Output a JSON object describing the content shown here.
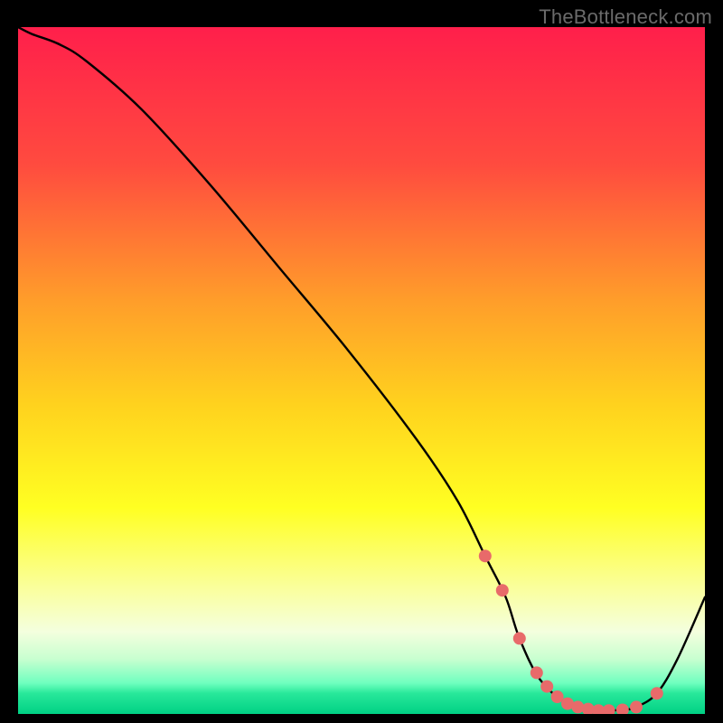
{
  "watermark": "TheBottleneck.com",
  "chart_data": {
    "type": "line",
    "title": "",
    "xlabel": "",
    "ylabel": "",
    "xlim": [
      0,
      100
    ],
    "ylim": [
      0,
      100
    ],
    "grid": false,
    "legend": false,
    "background_gradient": {
      "stops": [
        {
          "offset": 0.0,
          "color": "#ff1f4b"
        },
        {
          "offset": 0.2,
          "color": "#ff4b3f"
        },
        {
          "offset": 0.4,
          "color": "#ff9e2a"
        },
        {
          "offset": 0.55,
          "color": "#ffd21e"
        },
        {
          "offset": 0.7,
          "color": "#ffff22"
        },
        {
          "offset": 0.82,
          "color": "#faffa0"
        },
        {
          "offset": 0.88,
          "color": "#f4ffde"
        },
        {
          "offset": 0.92,
          "color": "#c8ffd0"
        },
        {
          "offset": 0.955,
          "color": "#6fffbf"
        },
        {
          "offset": 0.97,
          "color": "#28e89a"
        },
        {
          "offset": 1.0,
          "color": "#00d084"
        }
      ]
    },
    "curve": {
      "x": [
        0,
        2,
        6,
        10,
        18,
        28,
        38,
        48,
        58,
        64,
        68,
        71,
        73,
        76,
        80,
        84,
        88,
        90,
        93,
        96,
        100
      ],
      "y": [
        100,
        99,
        97.5,
        95,
        88,
        77,
        65,
        53,
        40,
        31,
        23,
        17,
        11,
        5,
        1.5,
        0.5,
        0.6,
        1.0,
        3.0,
        8.0,
        17.0
      ]
    },
    "markers": {
      "x": [
        68,
        70.5,
        73,
        75.5,
        77,
        78.5,
        80,
        81.5,
        83,
        84.5,
        86,
        88,
        90,
        93
      ],
      "y": [
        23,
        18,
        11,
        6,
        4,
        2.5,
        1.5,
        1.0,
        0.7,
        0.5,
        0.5,
        0.6,
        1.0,
        3.0
      ],
      "color": "#e86a6a",
      "radius": 7
    }
  }
}
